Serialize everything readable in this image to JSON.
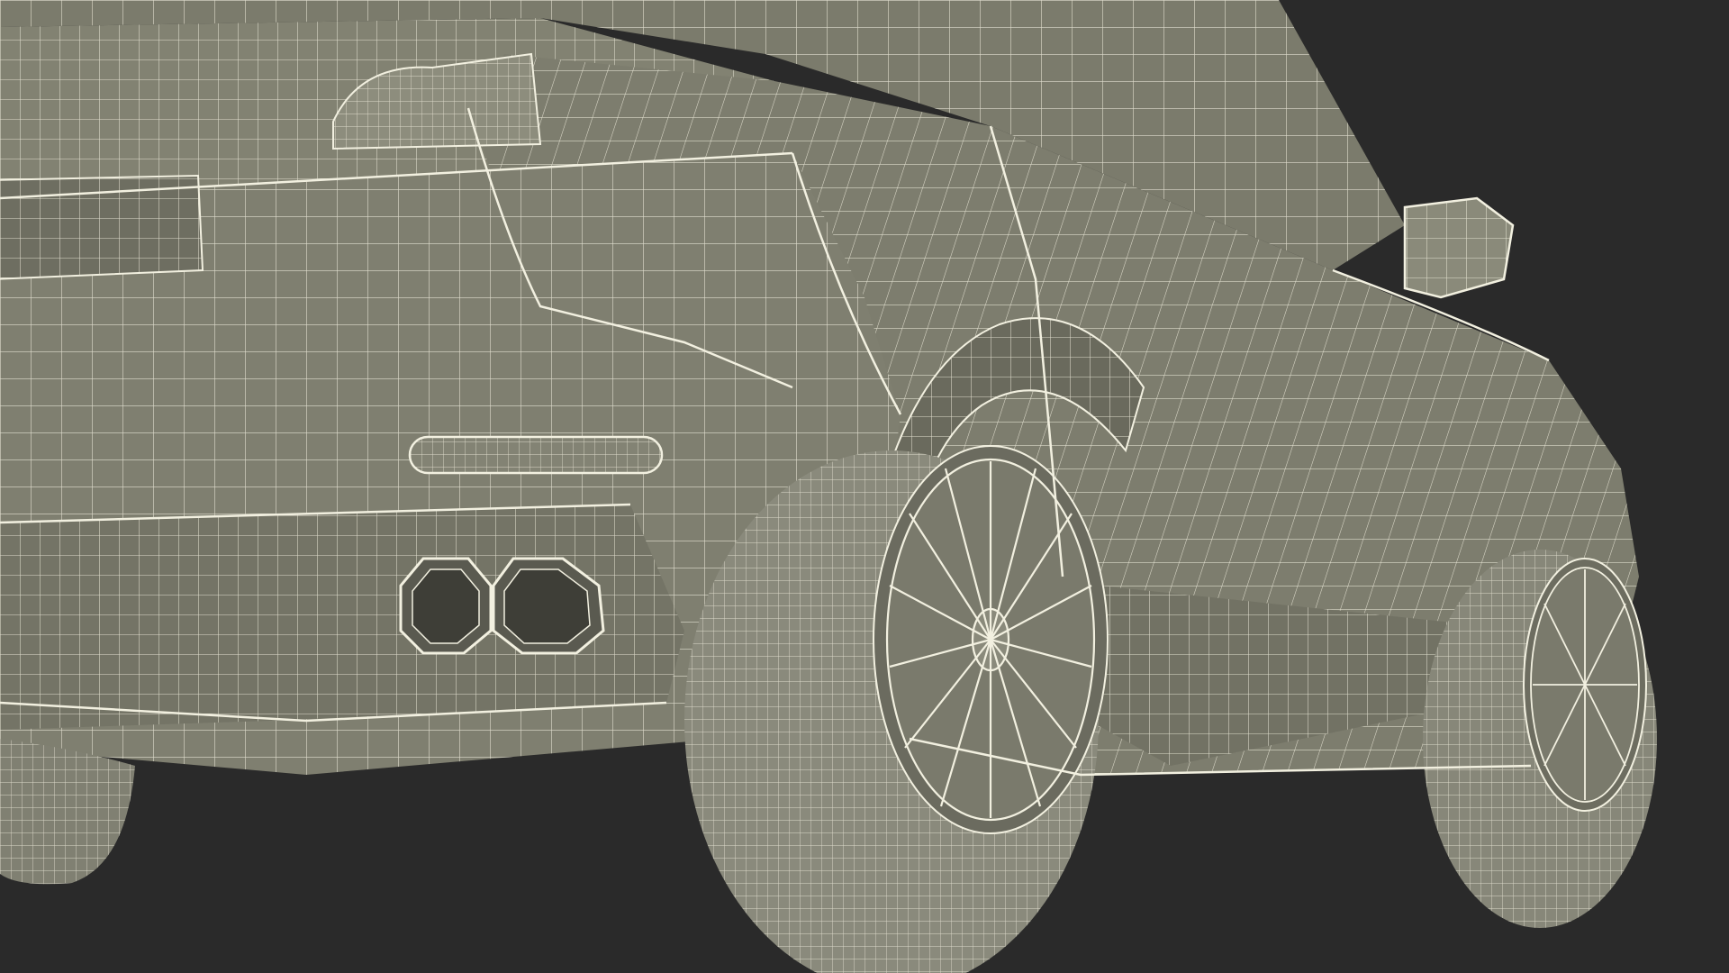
{
  "scene": {
    "subject": "",
    "render_style": "wireframe-over-solid",
    "colors": {
      "background": "#2a2a2a",
      "body_fill": "#7d7d6e",
      "body_fill_dark": "#5f5f53",
      "body_fill_light": "#8e8e7e",
      "wire": "#f2f0e0",
      "shadow": "#3c3c35"
    }
  }
}
